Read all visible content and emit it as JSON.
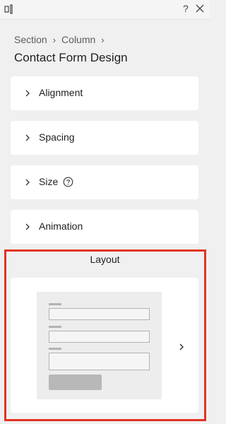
{
  "toolbar": {
    "layout_icon": "layout-toggle-icon",
    "help_icon": "question-icon",
    "help_glyph": "?",
    "close_icon": "close-icon"
  },
  "breadcrumb": {
    "items": [
      "Section",
      "Column"
    ],
    "separator": "›"
  },
  "page_title": "Contact Form Design",
  "panels": [
    {
      "label": "Alignment",
      "icon": "chevron-right-icon"
    },
    {
      "label": "Spacing",
      "icon": "chevron-right-icon"
    },
    {
      "label": "Size",
      "icon": "chevron-right-icon",
      "info_icon": "help-circle-icon"
    },
    {
      "label": "Animation",
      "icon": "chevron-right-icon"
    }
  ],
  "layout": {
    "title": "Layout",
    "next_icon": "chevron-right-icon"
  },
  "colors": {
    "highlight": "#e23324",
    "background": "#f0f0f0",
    "card": "#ffffff",
    "preview_bg": "#ededed",
    "preview_stroke": "#b3b3b3"
  }
}
